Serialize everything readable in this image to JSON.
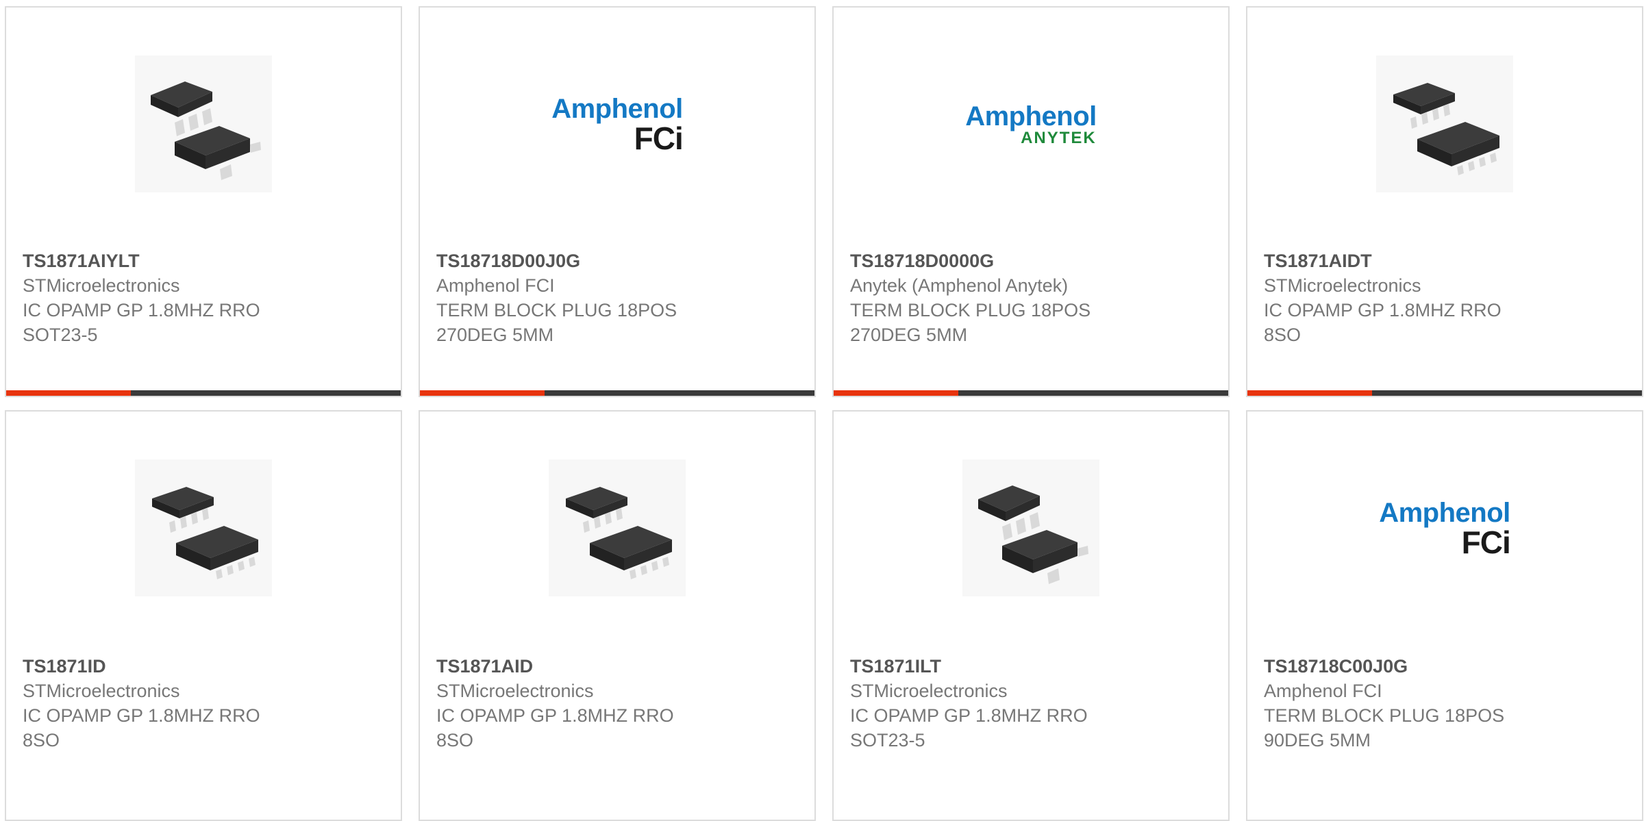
{
  "colors": {
    "accent": "#e8340e",
    "bar": "#3a3a3a",
    "amphenol_blue": "#1479c4",
    "anytek_green": "#1f8a3b",
    "text_primary": "#555555",
    "text_secondary": "#777777"
  },
  "products": [
    {
      "part_number": "TS1871AIYLT",
      "manufacturer": "STMicroelectronics",
      "desc_line1": "IC OPAMP GP 1.8MHZ RRO",
      "desc_line2": "SOT23-5",
      "image": "sot23-chip-icon"
    },
    {
      "part_number": "TS18718D00J0G",
      "manufacturer": "Amphenol FCI",
      "desc_line1": "TERM BLOCK PLUG 18POS",
      "desc_line2": "270DEG 5MM",
      "image": "amphenol-fci-logo",
      "logo_name": "Amphenol",
      "logo_sub": "FCi"
    },
    {
      "part_number": "TS18718D0000G",
      "manufacturer": "Anytek (Amphenol Anytek)",
      "desc_line1": "TERM BLOCK PLUG 18POS",
      "desc_line2": "270DEG 5MM",
      "image": "amphenol-anytek-logo",
      "logo_name": "Amphenol",
      "logo_sub": "ANYTEK"
    },
    {
      "part_number": "TS1871AIDT",
      "manufacturer": "STMicroelectronics",
      "desc_line1": "IC OPAMP GP 1.8MHZ RRO",
      "desc_line2": "8SO",
      "image": "so8-chip-icon"
    },
    {
      "part_number": "TS1871ID",
      "manufacturer": "STMicroelectronics",
      "desc_line1": "IC OPAMP GP 1.8MHZ RRO",
      "desc_line2": "8SO",
      "image": "so8-chip-icon"
    },
    {
      "part_number": "TS1871AID",
      "manufacturer": "STMicroelectronics",
      "desc_line1": "IC OPAMP GP 1.8MHZ RRO",
      "desc_line2": "8SO",
      "image": "so8-chip-icon"
    },
    {
      "part_number": "TS1871ILT",
      "manufacturer": "STMicroelectronics",
      "desc_line1": "IC OPAMP GP 1.8MHZ RRO",
      "desc_line2": "SOT23-5",
      "image": "sot23-chip-icon"
    },
    {
      "part_number": "TS18718C00J0G",
      "manufacturer": "Amphenol FCI",
      "desc_line1": "TERM BLOCK PLUG 18POS",
      "desc_line2": "90DEG 5MM",
      "image": "amphenol-fci-logo",
      "logo_name": "Amphenol",
      "logo_sub": "FCi"
    }
  ]
}
